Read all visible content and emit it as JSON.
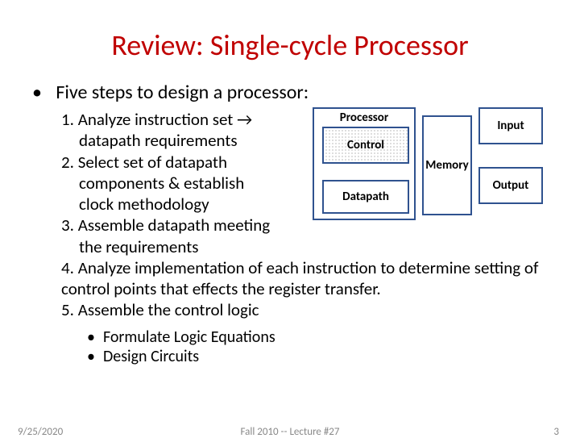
{
  "title": "Review: Single-cycle Processor",
  "lead_bullet": "Five steps to design a processor:",
  "steps": {
    "s1a": "1. Analyze instruction set →",
    "s1b": "datapath requirements",
    "s2a": "2. Select set of datapath",
    "s2b": "components & establish",
    "s2c": "clock methodology",
    "s3a": "3. Assemble datapath meeting",
    "s3b": "the requirements",
    "s4": "4. Analyze implementation of each instruction to determine setting of control points that effects the register transfer.",
    "s5": "5. Assemble the control logic"
  },
  "sub": {
    "a": "Formulate Logic Equations",
    "b": "Design Circuits"
  },
  "diagram": {
    "processor": "Processor",
    "control": "Control",
    "datapath": "Datapath",
    "memory": "Memory",
    "input": "Input",
    "output": "Output"
  },
  "footer": {
    "date": "9/25/2020",
    "mid": "Fall 2010 -- Lecture #27",
    "page": "3"
  }
}
